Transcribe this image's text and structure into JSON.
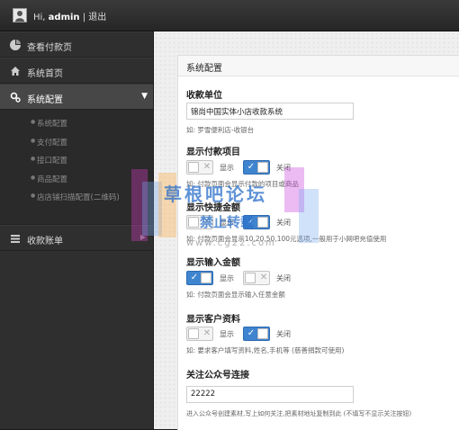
{
  "header": {
    "greeting": "Hi, ",
    "username": "admin",
    "separator": " | ",
    "logout": "退出"
  },
  "sidebar": {
    "items": [
      {
        "icon": "pie-icon",
        "label": "查看付款页"
      },
      {
        "icon": "home-icon",
        "label": "系统首页"
      },
      {
        "icon": "gears-icon",
        "label": "系统配置"
      },
      {
        "icon": "list-icon",
        "label": "收款账单"
      }
    ],
    "subitems": [
      "系统配置",
      "支付配置",
      "接口配置",
      "商品配置",
      "店店铺扫描配置(二维码)"
    ]
  },
  "panel": {
    "title": "系统配置",
    "payee": {
      "label": "收款单位",
      "value": "锦尚中国实体小店收款系统",
      "hint": "如: 罗雪便利店-收银台"
    },
    "show_items": {
      "label": "显示付款项目",
      "enabled": false,
      "hint": "如: 付款页面会显示付款的项目或商品"
    },
    "quick_amount": {
      "label": "显示快捷金额",
      "enabled": false,
      "hint": "如: 付款页面会显示10,20,50,100元选项,一般用于小网吧充值使用"
    },
    "input_amount": {
      "label": "显示输入金额",
      "enabled": true,
      "hint": "如: 付款页面会显示输入任意金额"
    },
    "customer": {
      "label": "显示客户资料",
      "enabled": false,
      "hint": "如: 要求客户填写资料,姓名,手机等 (慈善捐款可使用)"
    },
    "follow_link": {
      "label": "关注公众号连接",
      "value": "22222",
      "hint": "进入公众号创建素材,写上如何关注,把素材地址复制到此 (不填写不显示关注按钮)"
    },
    "on_label": "显示",
    "off_label": "关闭"
  },
  "watermark": {
    "line1": "草根吧论坛",
    "line2": "禁止转载",
    "line3": "www.cg22.com"
  },
  "colors": {
    "accent": "#3f84cf",
    "sidebar": "#2f2f2f",
    "topbar": "#2b2b2b"
  }
}
